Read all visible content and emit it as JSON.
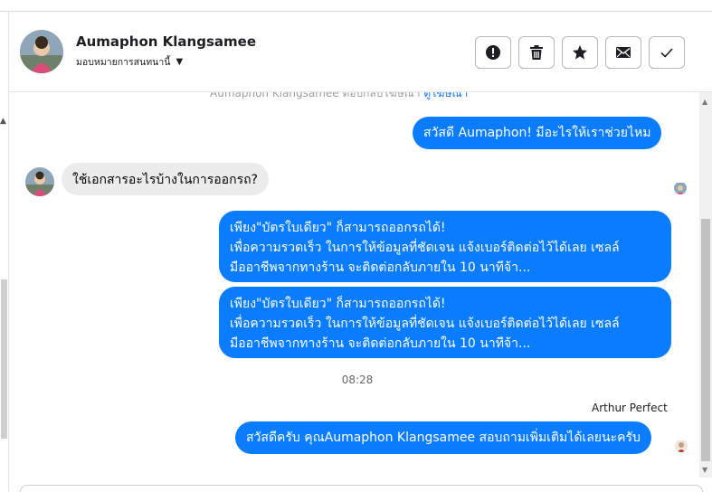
{
  "header": {
    "contact_name": "Aumaphon Klangsamee",
    "assign_label": "มอบหมายการสนทนานี้",
    "actions": [
      {
        "name": "spam-button",
        "icon": "exclamation-circle-icon"
      },
      {
        "name": "delete-button",
        "icon": "trash-icon"
      },
      {
        "name": "star-button",
        "icon": "star-icon"
      },
      {
        "name": "mark-unread-button",
        "icon": "envelope-icon"
      },
      {
        "name": "mark-done-button",
        "icon": "checkmark-icon"
      }
    ]
  },
  "chat": {
    "cut_note_text": "Aumaphon Klangsamee ตอบกลับโฆษณา",
    "cut_note_link": "ดูโฆษณา",
    "greeting_out": "สวัสดี Aumaphon! มีอะไรให้เราช่วยไหม",
    "question_in": "ใช้เอกสารอะไรบ้างในการออกรถ?",
    "reply1": {
      "line1": "เพียง\"บัตรใบเดียว\" ก็สามารถออกรถได้!",
      "line2": "เพื่อความรวดเร็ว ในการให้ข้อมูลที่ชัดเจน แจ้งเบอร์ติดต่อไว้ได้เลย เซลล์",
      "line3": "มืออาชีพจากทางร้าน จะติดต่อกลับภายใน 10 นาทีจ้า..."
    },
    "reply2": {
      "line1": "เพียง\"บัตรใบเดียว\" ก็สามารถออกรถได้!",
      "line2": "เพื่อความรวดเร็ว ในการให้ข้อมูลที่ชัดเจน แจ้งเบอร์ติดต่อไว้ได้เลย เซลล์",
      "line3": "มืออาชีพจากทางร้าน จะติดต่อกลับภายใน 10 นาทีจ้า..."
    },
    "timestamp": "08:28",
    "agent_name": "Arthur Perfect",
    "agent_reply": "สวัสดีครับ คุณAumaphon Klangsamee สอบถามเพิ่มเติมได้เลยนะครับ"
  },
  "colors": {
    "outgoing_bubble": "#0a7cff",
    "incoming_bubble": "#ececec"
  }
}
